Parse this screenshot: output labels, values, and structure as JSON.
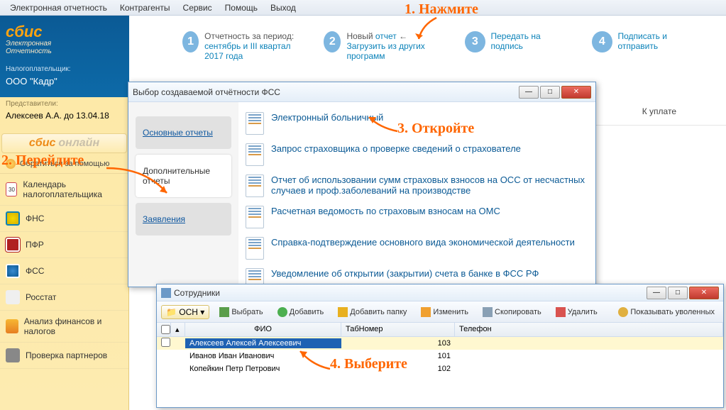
{
  "menu": {
    "m1": "Электронная отчетность",
    "m2": "Контрагенты",
    "m3": "Сервис",
    "m4": "Помощь",
    "m5": "Выход"
  },
  "logo": {
    "brand": "сбис",
    "sub1": "Электронная",
    "sub2": "Отчетность"
  },
  "payer": {
    "label": "Налогоплательщик:",
    "name": "ООО \"Кадр\""
  },
  "rep": {
    "label": "Представители:",
    "name": "Алексеев А.А. до 13.04.18"
  },
  "sbis_online": {
    "a": "сбис",
    "b": "онлайн"
  },
  "help": "Обратиться за помощью",
  "nav": {
    "cal": "Календарь налогоплательщика",
    "fns": "ФНС",
    "pfr": "ПФР",
    "fss": "ФСС",
    "rosstat": "Росстат",
    "fin": "Анализ финансов и налогов",
    "check": "Проверка партнеров"
  },
  "steps": {
    "s1a": "Отчетность за период:",
    "s1b": "сентябрь и III квартал 2017 года",
    "s2a": "Новый ",
    "s2link": "отчет",
    "s2b": "Загрузить из других программ",
    "s3": "Передать на подпись",
    "s4": "Подписать и отправить"
  },
  "maintab": "К уплате",
  "annotations": {
    "a1": "1. Нажмите",
    "a2": "2. Перейдите",
    "a3": "3. Откройте",
    "a4": "4. Выберите"
  },
  "modal1": {
    "title": "Выбор создаваемой отчётности ФСС",
    "tabs": {
      "t1": "Основные отчеты",
      "t2": "Дополнительные отчеты",
      "t3": "Заявления"
    },
    "items": [
      "Электронный больничный",
      "Запрос страховщика о проверке сведений о страхователе",
      "Отчет об использовании сумм страховых взносов на ОСС от несчастных случаев и проф.заболеваний на производстве",
      "Расчетная ведомость по страховым взносам на ОМС",
      "Справка-подтверждение основного вида экономической деятельности",
      "Уведомление об открытии (закрытии) счета в банке в ФСС РФ"
    ]
  },
  "modal2": {
    "title": "Сотрудники",
    "folder": "ОСН",
    "tb": {
      "sel": "Выбрать",
      "add": "Добавить",
      "addf": "Добавить папку",
      "edit": "Изменить",
      "copy": "Скопировать",
      "del": "Удалить",
      "show": "Показывать уволенных"
    },
    "cols": {
      "fio": "ФИО",
      "tab": "ТабНомер",
      "tel": "Телефон"
    },
    "rows": [
      {
        "fio": "Алексеев Алексей Алексеевич",
        "tab": "103",
        "tel": ""
      },
      {
        "fio": "Иванов Иван Иванович",
        "tab": "101",
        "tel": ""
      },
      {
        "fio": "Копейкин Петр Петрович",
        "tab": "102",
        "tel": ""
      }
    ]
  }
}
